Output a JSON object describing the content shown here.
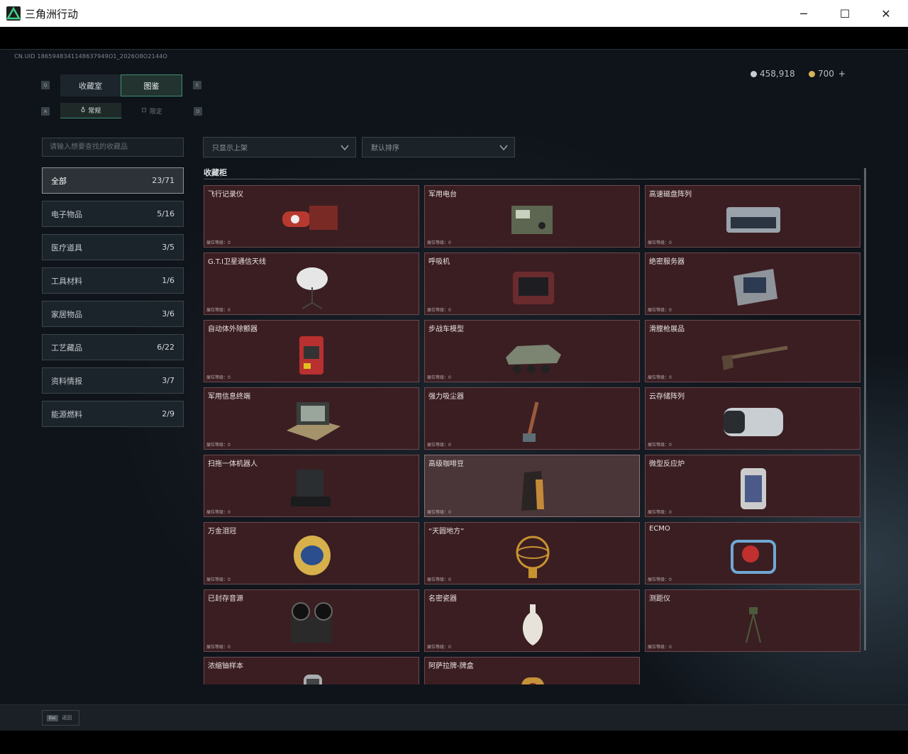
{
  "window": {
    "title": "三角洲行动",
    "minimize": "─",
    "maximize": "☐",
    "close": "✕"
  },
  "uid": "CN.UID 1865948341148637949O1_2026O8O2144O",
  "currency": {
    "silver": "458,918",
    "gold": "700",
    "plus": "+"
  },
  "keys": {
    "tab_prev": "Q",
    "tab_next": "E",
    "sub_prev": "A",
    "sub_next": "D"
  },
  "tabs": [
    {
      "label": "收藏室",
      "active": false
    },
    {
      "label": "图鉴",
      "active": true
    }
  ],
  "subtabs": [
    {
      "label": "常规",
      "icon": "♁",
      "active": true
    },
    {
      "label": "限定",
      "icon": "⊡",
      "active": false
    }
  ],
  "search": {
    "placeholder": "请输入想要查找的收藏品"
  },
  "categories": [
    {
      "label": "全部",
      "count": "23/71",
      "active": true
    },
    {
      "label": "电子物品",
      "count": "5/16"
    },
    {
      "label": "医疗道具",
      "count": "3/5"
    },
    {
      "label": "工具材料",
      "count": "1/6"
    },
    {
      "label": "家居物品",
      "count": "3/6"
    },
    {
      "label": "工艺藏品",
      "count": "6/22"
    },
    {
      "label": "资料情报",
      "count": "3/7"
    },
    {
      "label": "能源燃料",
      "count": "2/9"
    }
  ],
  "filters": {
    "shelf": "只显示上架",
    "sort": "默认排序"
  },
  "section_title": "收藏柜",
  "level_label": "展位等级：0",
  "items": [
    {
      "name": "飞行记录仪",
      "icon": "flight-recorder-icon",
      "color": "#b8392f"
    },
    {
      "name": "军用电台",
      "icon": "military-radio-icon",
      "color": "#5c6650"
    },
    {
      "name": "高速磁盘阵列",
      "icon": "disk-array-icon",
      "color": "#9aa3ab"
    },
    {
      "name": "G.T.I卫星通信天线",
      "icon": "satellite-dish-icon",
      "color": "#e6e6e6"
    },
    {
      "name": "呼吸机",
      "icon": "ventilator-icon",
      "color": "#6a2b2e"
    },
    {
      "name": "绝密服务器",
      "icon": "server-icon",
      "color": "#8e949a"
    },
    {
      "name": "自动体外除颤器",
      "icon": "defibrillator-icon",
      "color": "#b8302f"
    },
    {
      "name": "步战车模型",
      "icon": "ifv-model-icon",
      "color": "#7c8472"
    },
    {
      "name": "滑膛枪展品",
      "icon": "musket-icon",
      "color": "#6d5a44"
    },
    {
      "name": "军用信息终端",
      "icon": "field-terminal-icon",
      "color": "#a3926a"
    },
    {
      "name": "强力吸尘器",
      "icon": "vacuum-icon",
      "color": "#9a5a3c"
    },
    {
      "name": "云存储阵列",
      "icon": "cloud-storage-icon",
      "color": "#c9ced2"
    },
    {
      "name": "扫拖一体机器人",
      "icon": "robot-vacuum-icon",
      "color": "#2b2e31",
      "highlight": false
    },
    {
      "name": "高级咖啡豆",
      "icon": "coffee-bag-icon",
      "color": "#2a2524",
      "highlight": true
    },
    {
      "name": "微型反应炉",
      "icon": "reactor-icon",
      "color": "#4c5a8a"
    },
    {
      "name": "万金泪冠",
      "icon": "jeweled-egg-icon",
      "color": "#d6b04a"
    },
    {
      "name": "“天圆地方”",
      "icon": "armillary-sphere-icon",
      "color": "#c8922e"
    },
    {
      "name": "ECMO",
      "icon": "ecmo-icon",
      "color": "#6ea8d4"
    },
    {
      "name": "已封存音源",
      "icon": "tape-recorder-icon",
      "color": "#2a2a2a"
    },
    {
      "name": "名密瓷器",
      "icon": "porcelain-vase-icon",
      "color": "#e7e3da"
    },
    {
      "name": "测距仪",
      "icon": "rangefinder-icon",
      "color": "#4c5a3a"
    },
    {
      "name": "浓缩铀样本",
      "icon": "uranium-sample-icon",
      "color": "#a9adb0"
    },
    {
      "name": "阿萨拉牌-牌盒",
      "icon": "card-box-icon",
      "color": "#c4923a"
    }
  ],
  "footer": {
    "esc_key": "Esc",
    "esc_label": "返回"
  }
}
